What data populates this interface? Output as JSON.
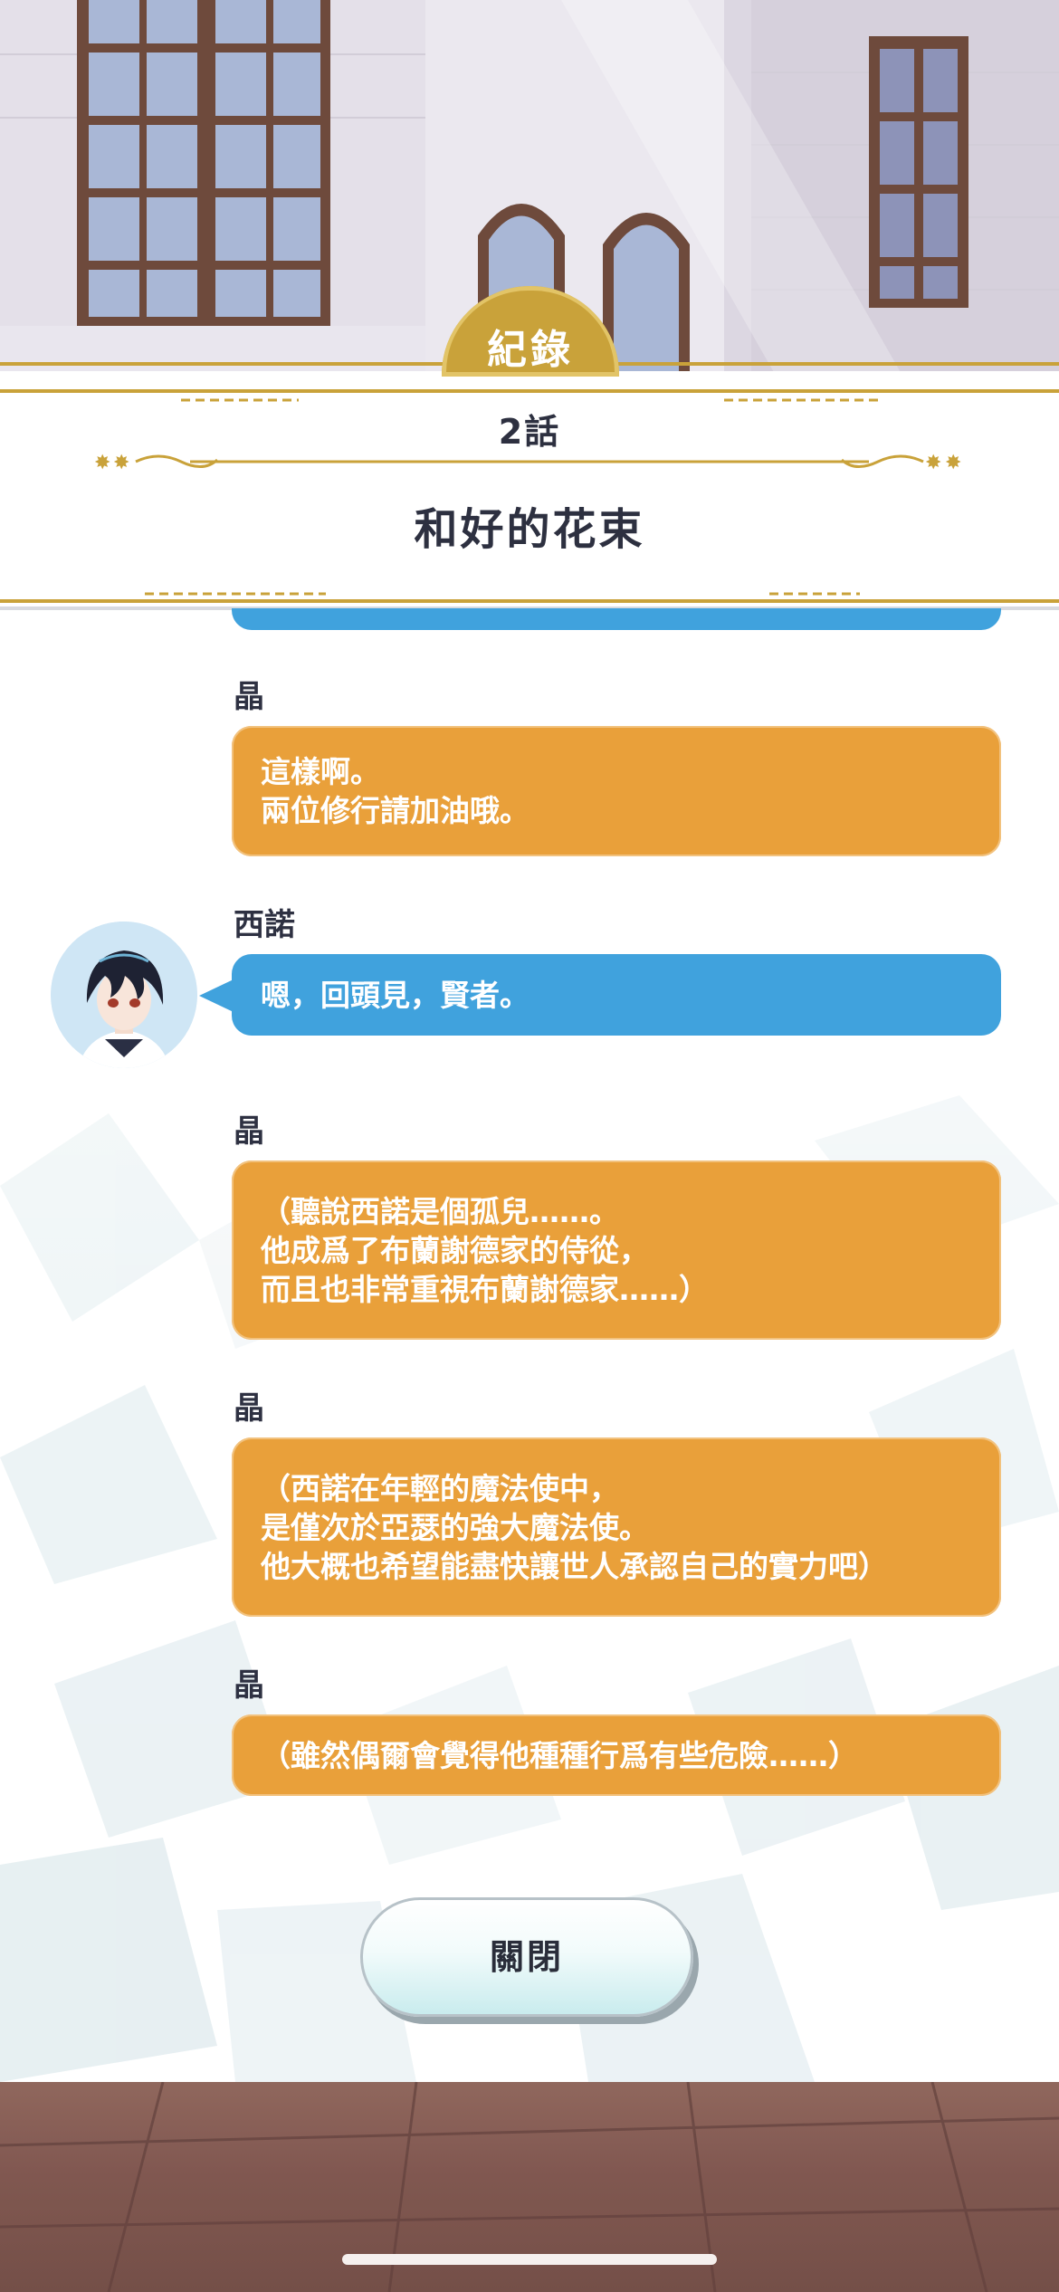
{
  "record_tab": {
    "label": "紀錄"
  },
  "episode": {
    "number": "2話",
    "title": "和好的花束"
  },
  "messages": [
    {
      "speaker": "晶",
      "color": "#e9a03a",
      "lines": [
        "這樣啊。",
        "兩位修行請加油哦。"
      ]
    },
    {
      "speaker": "西諾",
      "color": "#40a2dd",
      "avatar": "sinor-avatar",
      "lines": [
        "嗯，回頭見，賢者。"
      ]
    },
    {
      "speaker": "晶",
      "color": "#e9a03a",
      "lines": [
        "（聽說西諾是個孤兒……。",
        "他成爲了布蘭謝德家的侍從，",
        "而且也非常重視布蘭謝德家……）"
      ]
    },
    {
      "speaker": "晶",
      "color": "#e9a03a",
      "lines": [
        "（西諾在年輕的魔法使中，",
        "是僅次於亞瑟的強大魔法使。",
        "他大概也希望能盡快讓世人承認自己的實力吧）"
      ]
    },
    {
      "speaker": "晶",
      "color": "#e9a03a",
      "lines": [
        "（雖然偶爾會覺得他種種行爲有些危險……）"
      ]
    }
  ],
  "close_button": {
    "label": "關閉"
  },
  "colors": {
    "gold": "#c9a23a",
    "orange_bubble": "#e9a03a",
    "blue_bubble": "#40a2dd",
    "title_text": "#2d3040"
  }
}
